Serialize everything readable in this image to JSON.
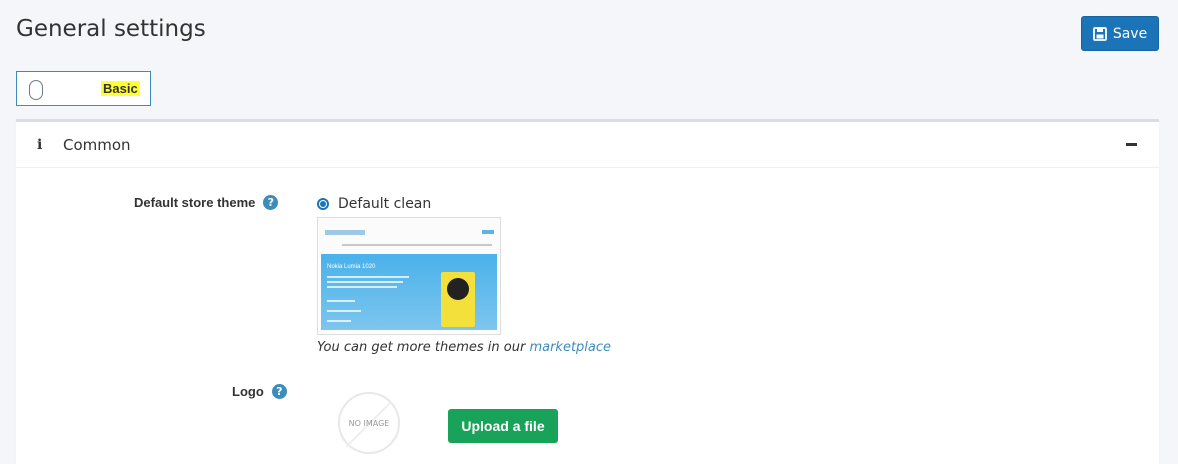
{
  "header": {
    "title": "General settings",
    "save_label": "Save"
  },
  "mode_toggle": {
    "label": "Basic"
  },
  "section": {
    "title": "Common",
    "info_icon": "info-icon",
    "collapse_icon": "minus-icon"
  },
  "fields": {
    "default_store_theme": {
      "label": "Default store theme",
      "help_icon": "question-icon",
      "selected_option": "Default clean",
      "preview_banner_title": "Nokia Lumia 1020",
      "help_text_prefix": "You can get more themes in our ",
      "help_link": "marketplace"
    },
    "logo": {
      "label": "Logo",
      "help_icon": "question-icon",
      "no_image_text": "NO IMAGE",
      "upload_label": "Upload a file"
    }
  },
  "colors": {
    "primary": "#1b74b8",
    "success": "#19a35a",
    "highlight": "#ffff33"
  }
}
